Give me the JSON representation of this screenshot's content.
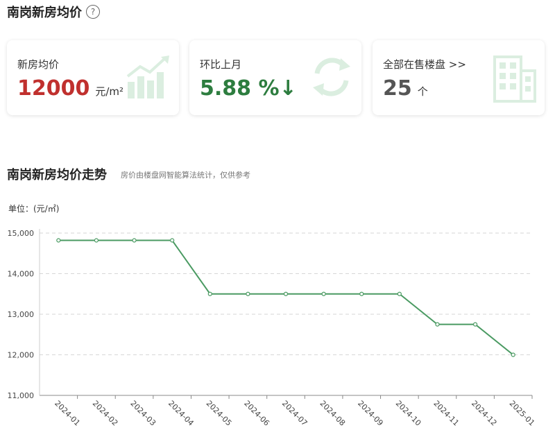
{
  "header": {
    "title": "南岗新房均价",
    "help_glyph": "?"
  },
  "cards": [
    {
      "label": "新房均价",
      "value": "12000",
      "unit": "元/m²",
      "icon": "bar-chart-rising-icon"
    },
    {
      "label": "环比上月",
      "value": "5.88 %↓",
      "unit": "",
      "icon": "refresh-arrows-icon"
    },
    {
      "label": "全部在售楼盘 >>",
      "value": "25",
      "unit": "个",
      "icon": "building-icon"
    }
  ],
  "colors": {
    "red": "#c0302e",
    "green": "#2d7d3f",
    "line": "#4a9a62",
    "deco": "#dbeee0"
  },
  "trend": {
    "title": "南岗新房均价走势",
    "subtitle": "房价由楼盘网智能算法统计，仅供参考"
  },
  "chart_data": {
    "type": "line",
    "unit_label": "单位：(元/㎡)",
    "x": [
      "2024-01",
      "2024-02",
      "2024-03",
      "2024-04",
      "2024-05",
      "2024-06",
      "2024-07",
      "2024-08",
      "2024-09",
      "2024-10",
      "2024-11",
      "2024-12",
      "2025-01"
    ],
    "series": [
      {
        "values": [
          14820,
          14820,
          14820,
          14820,
          13500,
          13500,
          13500,
          13500,
          13500,
          13500,
          12750,
          12750,
          12000
        ]
      }
    ],
    "yticks": [
      "15,000",
      "14,000",
      "13,000",
      "12,000",
      "11,000"
    ],
    "ylim": [
      11000,
      15000
    ],
    "grid": true,
    "legend": "none"
  }
}
